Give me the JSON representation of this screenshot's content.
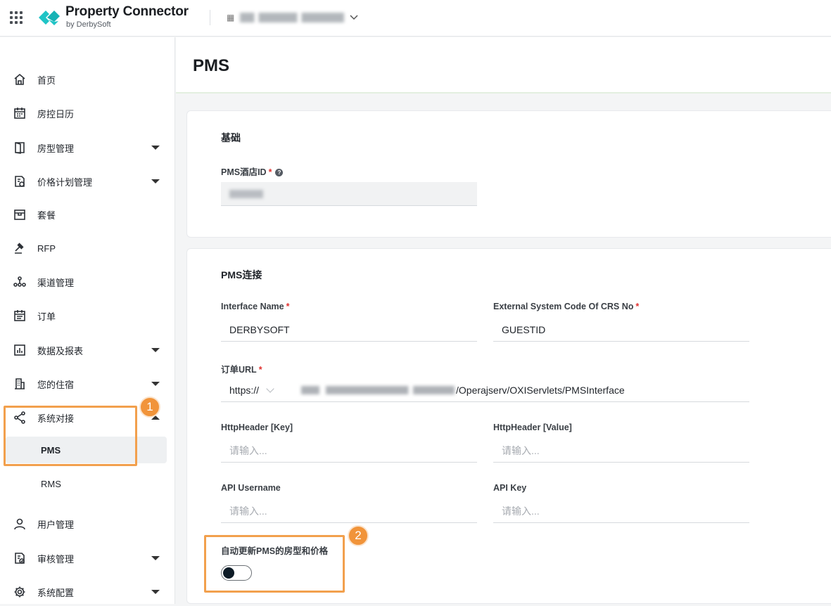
{
  "app": {
    "brand_title": "Property Connector",
    "brand_subtitle": "by DerbySoft",
    "brand_color": "#1fc4c6"
  },
  "sidebar": {
    "items": [
      {
        "label": "首页",
        "icon": "home-icon"
      },
      {
        "label": "房控日历",
        "icon": "calendar-icon"
      },
      {
        "label": "房型管理",
        "icon": "door-icon"
      },
      {
        "label": "价格计划管理",
        "icon": "price-plan-icon"
      },
      {
        "label": "套餐",
        "icon": "package-icon"
      },
      {
        "label": "RFP",
        "icon": "gavel-icon"
      },
      {
        "label": "渠道管理",
        "icon": "channel-icon"
      },
      {
        "label": "订单",
        "icon": "order-icon"
      },
      {
        "label": "数据及报表",
        "icon": "chart-icon"
      },
      {
        "label": "您的住宿",
        "icon": "building-icon"
      },
      {
        "label": "系统对接",
        "icon": "share-icon"
      },
      {
        "label": "用户管理",
        "icon": "user-icon"
      },
      {
        "label": "审核管理",
        "icon": "audit-icon"
      },
      {
        "label": "系统配置",
        "icon": "gear-icon"
      }
    ],
    "sub_items": {
      "pms": "PMS",
      "rms": "RMS"
    }
  },
  "page": {
    "title": "PMS"
  },
  "basic": {
    "title": "基础",
    "hotel_id_label": "PMS酒店ID"
  },
  "connection": {
    "title": "PMS连接",
    "interface_name_label": "Interface Name",
    "interface_name_value": "DERBYSOFT",
    "ext_code_label": "External System Code Of CRS No",
    "ext_code_value": "GUESTID",
    "order_url_label": "订单URL",
    "order_url_protocol": "https://",
    "order_url_path": "/Operajserv/OXIServlets/PMSInterface",
    "header_key_label": "HttpHeader [Key]",
    "header_value_label": "HttpHeader [Value]",
    "api_username_label": "API Username",
    "api_key_label": "API Key",
    "placeholder": "请输入...",
    "auto_update_label": "自动更新PMS的房型和价格",
    "auto_update_on": false
  },
  "annotations": {
    "badge1": "1",
    "badge2": "2",
    "color": "#f2a04d"
  },
  "required_mark": "*",
  "help_mark": "?"
}
